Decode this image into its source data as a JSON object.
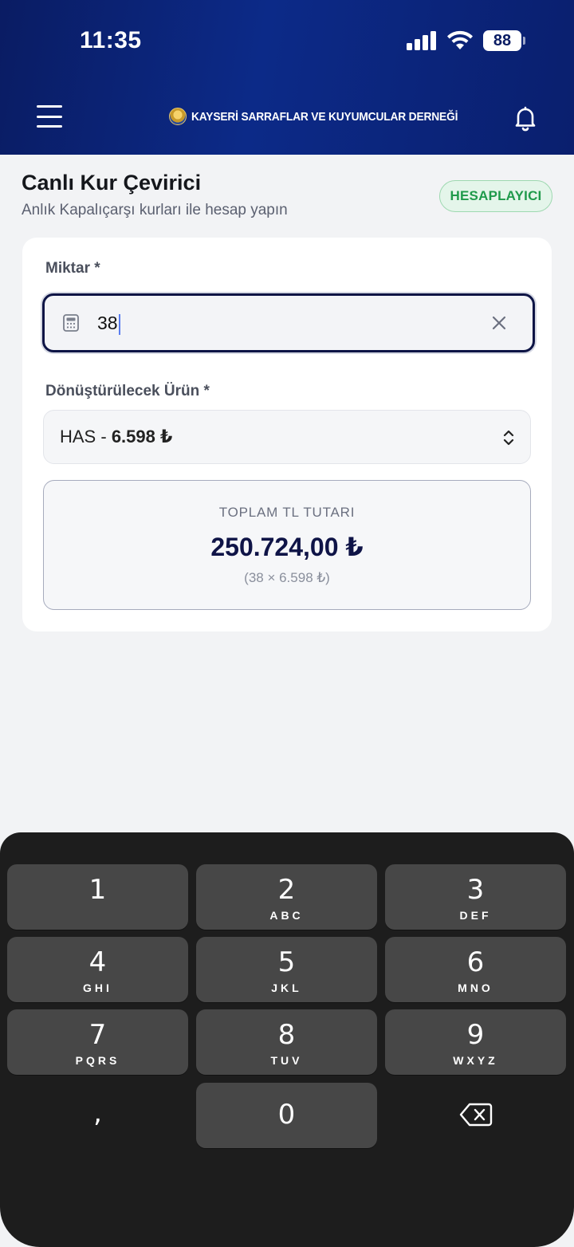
{
  "status_bar": {
    "time": "11:35",
    "battery": "88"
  },
  "header": {
    "brand": "KAYSERİ SARRAFLAR VE KUYUMCULAR DERNEĞİ"
  },
  "page": {
    "title": "Canlı Kur Çevirici",
    "subtitle": "Anlık Kapalıçarşı kurları ile hesap yapın",
    "badge": "HESAPLAYICI"
  },
  "form": {
    "amount_label": "Miktar *",
    "amount_value": "38",
    "product_label": "Dönüştürülecek Ürün *",
    "product_name": "HAS -",
    "product_price": "6.598 ₺",
    "result_label": "TOPLAM TL TUTARI",
    "result_value": "250.724,00 ₺",
    "result_formula": "(38 × 6.598 ₺)"
  },
  "keyboard": {
    "keys": [
      {
        "num": "1",
        "letters": ""
      },
      {
        "num": "2",
        "letters": "ABC"
      },
      {
        "num": "3",
        "letters": "DEF"
      },
      {
        "num": "4",
        "letters": "GHI"
      },
      {
        "num": "5",
        "letters": "JKL"
      },
      {
        "num": "6",
        "letters": "MNO"
      },
      {
        "num": "7",
        "letters": "PQRS"
      },
      {
        "num": "8",
        "letters": "TUV"
      },
      {
        "num": "9",
        "letters": "WXYZ"
      },
      {
        "num": "0",
        "letters": ""
      }
    ],
    "comma": ","
  },
  "icons": {
    "menu": "menu-icon",
    "bell": "bell-icon",
    "calculator": "calculator-icon",
    "clear": "close-icon",
    "select": "chevron-updown-icon",
    "backspace": "backspace-icon"
  },
  "colors": {
    "header": "#0a1c63",
    "accent_green": "#1f9a4b",
    "result_value": "#0f1447"
  }
}
